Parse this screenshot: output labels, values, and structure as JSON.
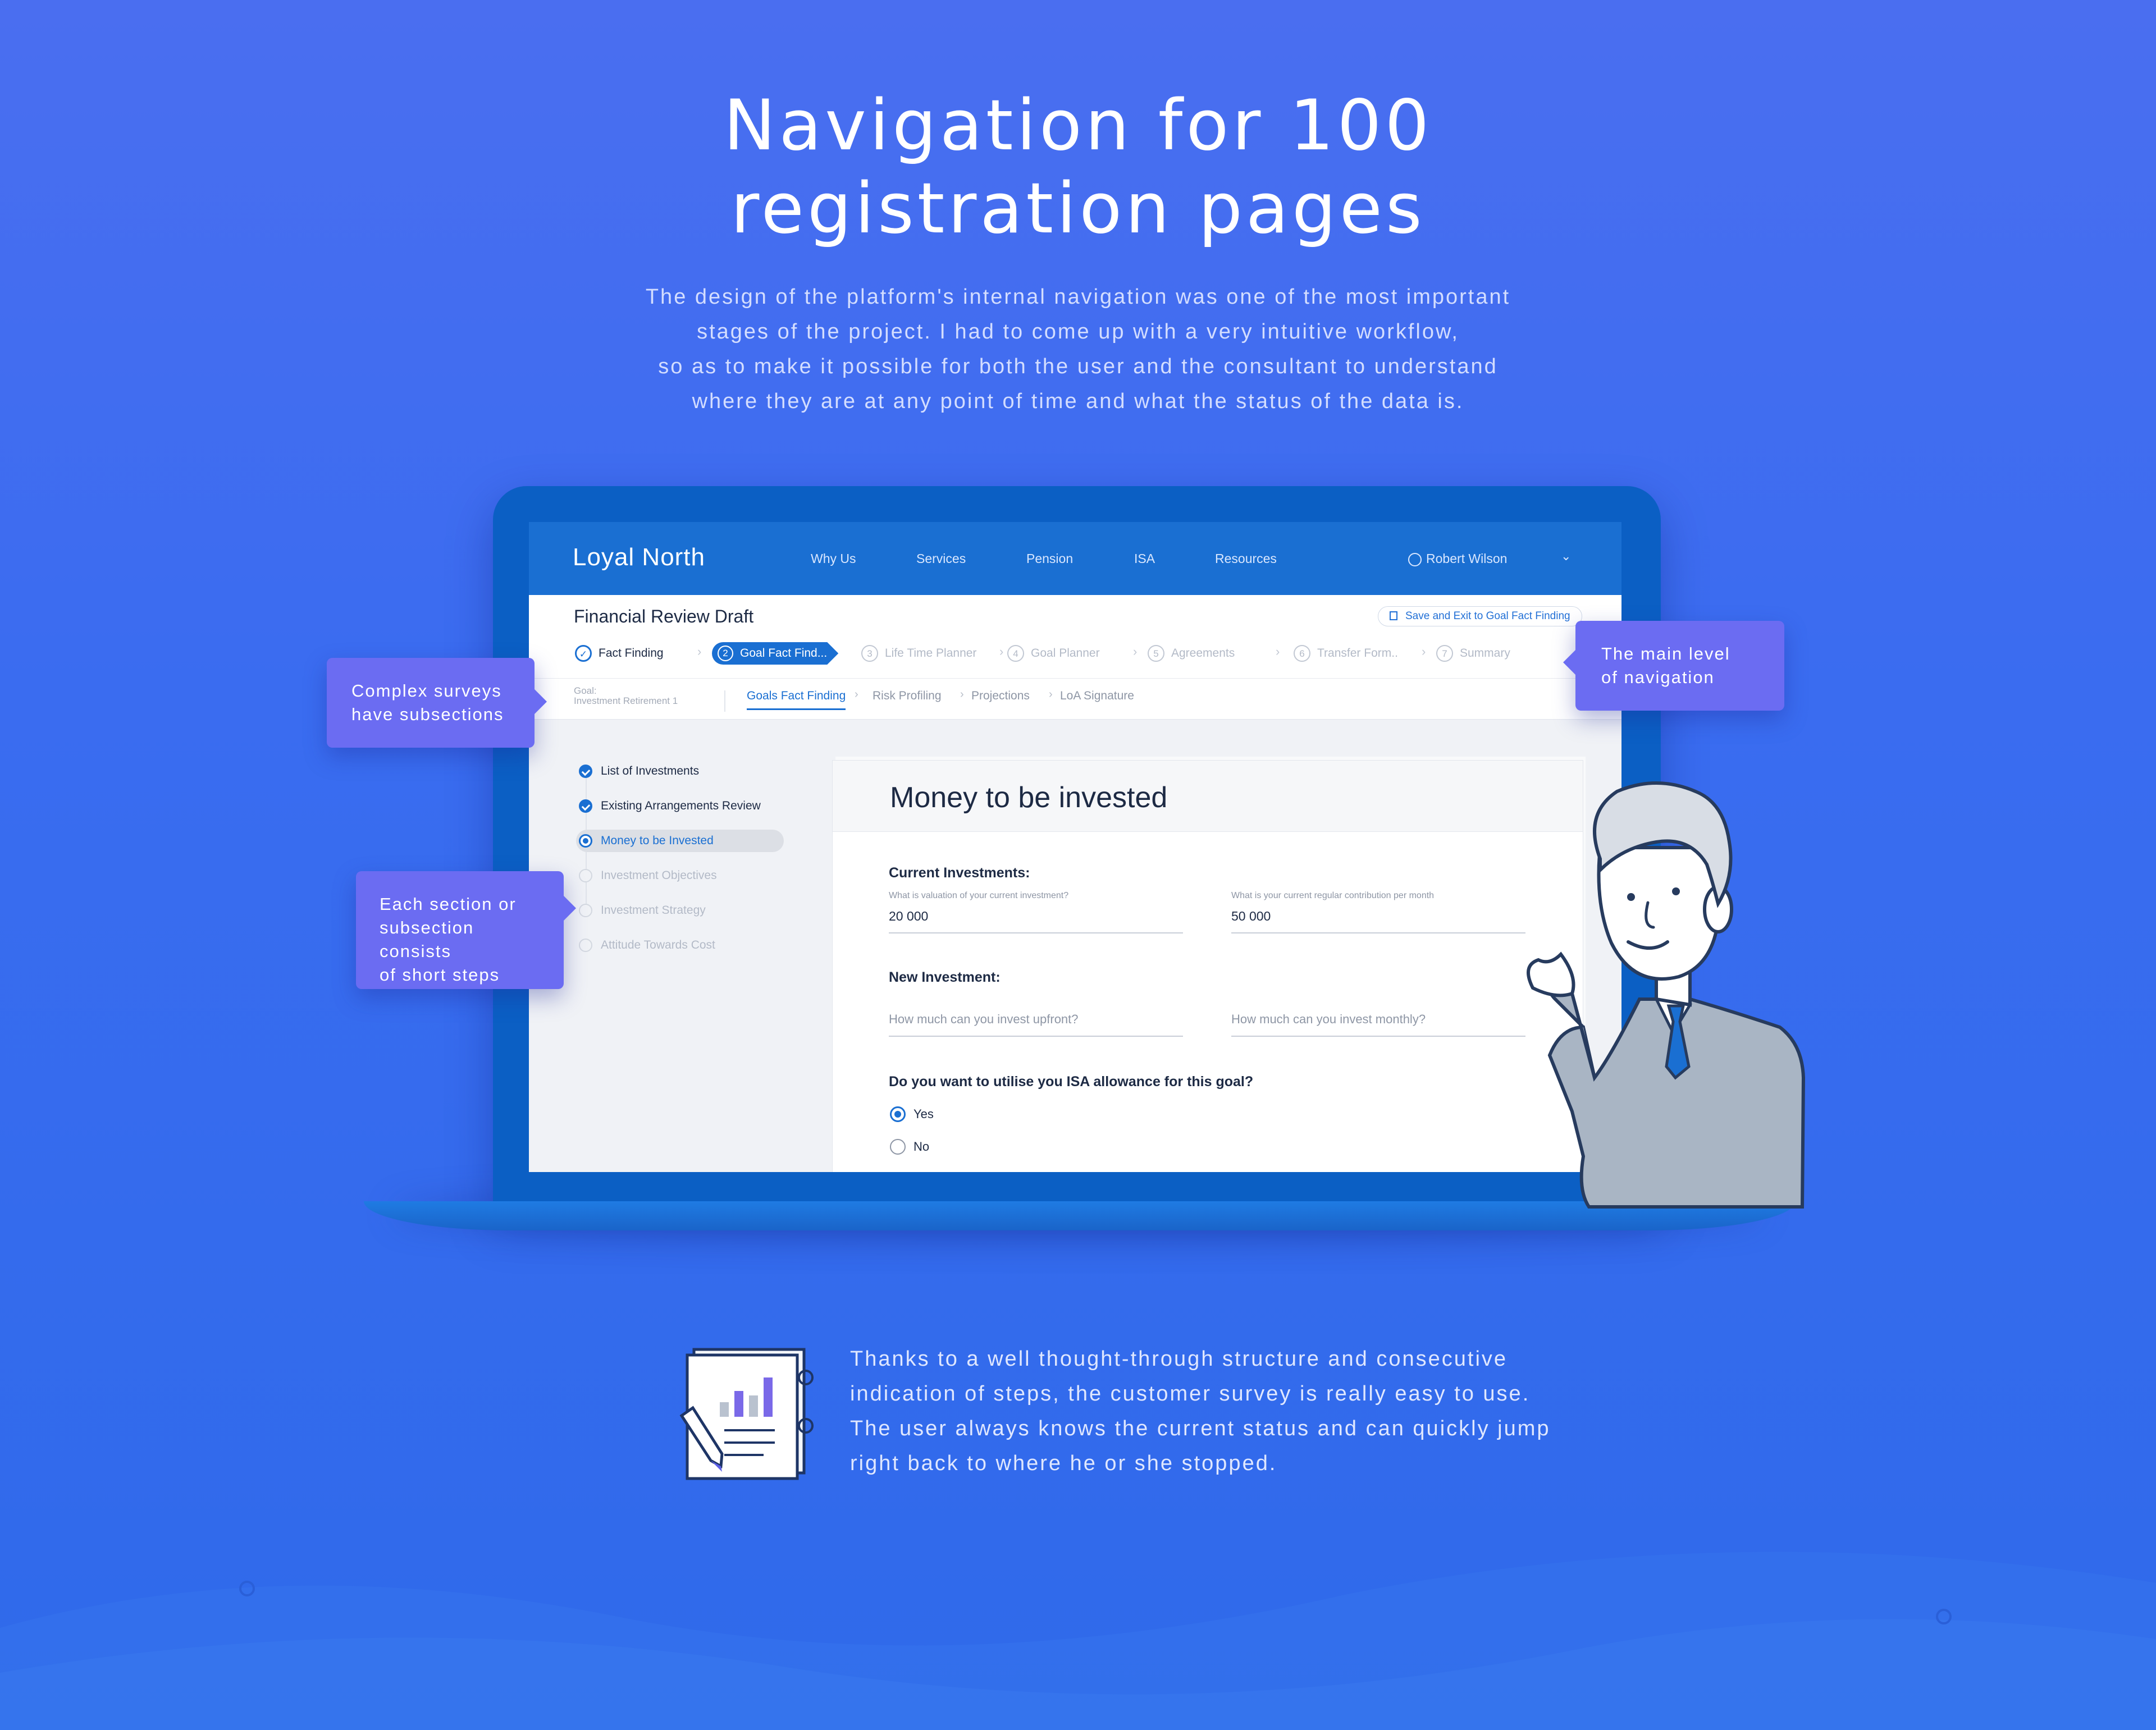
{
  "hero": {
    "title_line1": "Navigation for 100",
    "title_line2": "registration pages",
    "desc": [
      "The design of the platform's internal navigation was one of the most important",
      "stages of the project. I had to come up with a very intuitive workflow,",
      "so as to make it possible for both the user and the consultant to understand",
      "where they are at any point of time and what the status of the data is."
    ]
  },
  "app": {
    "brand": "Loyal North",
    "nav": [
      "Why Us",
      "Services",
      "Pension",
      "ISA",
      "Resources"
    ],
    "user": "Robert Wilson",
    "user_chevron": "⌄",
    "draft_title": "Financial Review Draft",
    "save_button": "Save and Exit to Goal Fact Finding",
    "steps": [
      {
        "num": "✓",
        "label": "Fact Finding",
        "state": "done"
      },
      {
        "num": "2",
        "label": "Goal Fact Find...",
        "state": "active"
      },
      {
        "num": "3",
        "label": "Life Time Planner",
        "state": "todo"
      },
      {
        "num": "4",
        "label": "Goal Planner",
        "state": "todo"
      },
      {
        "num": "5",
        "label": "Agreements",
        "state": "todo"
      },
      {
        "num": "6",
        "label": "Transfer Form..",
        "state": "todo"
      },
      {
        "num": "7",
        "label": "Summary",
        "state": "todo"
      }
    ],
    "goal_label": "Goal:",
    "goal_value": "Investment Retirement 1",
    "subnav": [
      "Goals Fact Finding",
      "Risk Profiling",
      "Projections",
      "LoA Signature"
    ],
    "sidebar": [
      {
        "label": "List of Investments",
        "state": "done"
      },
      {
        "label": "Existing Arrangements Review",
        "state": "done"
      },
      {
        "label": "Money to be Invested",
        "state": "current"
      },
      {
        "label": "Investment Objectives",
        "state": "todo"
      },
      {
        "label": "Investment Strategy",
        "state": "todo"
      },
      {
        "label": "Attitude Towards Cost",
        "state": "todo"
      }
    ],
    "form": {
      "title": "Money to be invested",
      "current_heading": "Current Investments:",
      "current_q1": "What is valuation of your current investment?",
      "current_v1": "20 000",
      "current_q2": "What is your current regular contribution per month",
      "current_v2": "50 000",
      "new_heading": "New Investment:",
      "new_ph1": "How much can you invest upfront?",
      "new_ph2": "How much can you invest monthly?",
      "isa_question": "Do you want to utilise you ISA allowance for this goal?",
      "options": [
        "Yes",
        "No"
      ],
      "selected": "Yes"
    }
  },
  "callouts": {
    "left1": [
      "Complex surveys",
      "have subsections"
    ],
    "left2": [
      "Each section or",
      "subsection consists",
      "of short steps"
    ],
    "right": [
      "The main level",
      "of navigation"
    ]
  },
  "bottom": {
    "text": [
      "Thanks to a well thought-through structure and consecutive",
      "indication of steps, the customer survey is really easy to use.",
      "The user always knows the current status and can quickly jump",
      "right back to where he or she stopped."
    ]
  },
  "colors": {
    "background": "#3a6cf0",
    "app_blue": "#1a6fd2",
    "callout": "#6b6cf2"
  }
}
